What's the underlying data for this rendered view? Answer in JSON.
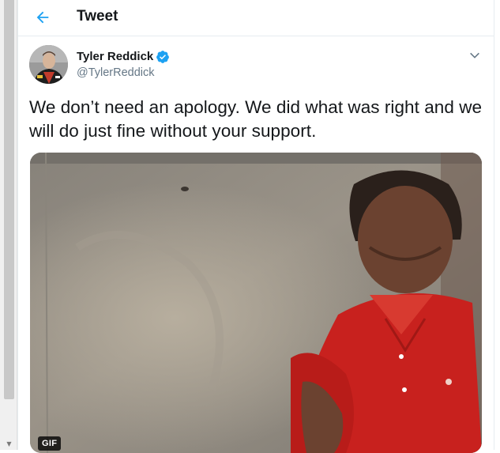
{
  "header": {
    "title": "Tweet",
    "back_icon": "arrow-left-icon"
  },
  "tweet": {
    "author_name": "Tyler Reddick",
    "author_handle": "@TylerReddick",
    "verified": true,
    "text": "We don’t need an apology. We did what was right and we will do just fine without your support.",
    "media": {
      "type": "gif",
      "badge": "GIF"
    }
  },
  "colors": {
    "accent": "#1da1f2",
    "text": "#14171a",
    "secondary_text": "#657786",
    "shirt_red": "#c8211e"
  }
}
